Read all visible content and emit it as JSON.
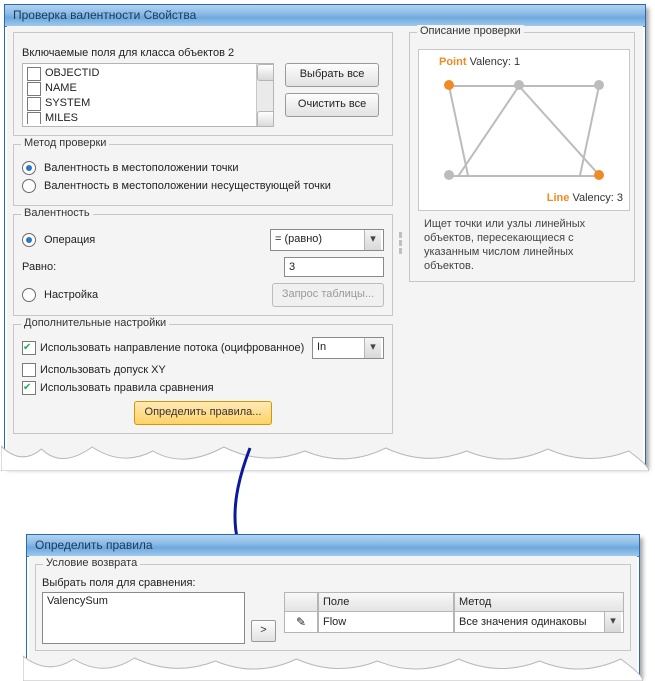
{
  "win1": {
    "title": "Проверка валентности Свойства",
    "fields_title": "Включаемые поля для класса объектов 2",
    "fields": [
      "OBJECTID",
      "NAME",
      "SYSTEM",
      "MILES"
    ],
    "btn_select_all": "Выбрать все",
    "btn_clear_all": "Очистить все",
    "method_title": "Метод проверки",
    "method_opt1": "Валентность в местоположении точки",
    "method_opt2": "Валентность в местоположении несуществующей точки",
    "valency_title": "Валентность",
    "valency_operation": "Операция",
    "valency_operator": "= (равно)",
    "valency_equals_label": "Равно:",
    "valency_equals_value": "3",
    "valency_tuning": "Настройка",
    "valency_query_btn": "Запрос таблицы...",
    "extra_title": "Дополнительные настройки",
    "extra_flow": "Использовать  направление  потока  (оцифрованное)",
    "extra_flow_sel": "In",
    "extra_xy": "Использовать допуск XY",
    "extra_rules": "Использовать правила сравнения",
    "define_rules_btn": "Определить правила...",
    "right_title": "Описание проверки",
    "preview_point_label": "Point",
    "preview_point_val": "Valency: 1",
    "preview_line_label": "Line",
    "preview_line_val": "Valency: 3",
    "desc": "Ищет точки или узлы линейных объектов, пересекающиеся с указанным числом линейных объектов."
  },
  "win2": {
    "title": "Определить правила",
    "cond_title": "Условие возврата",
    "pick_label": "Выбрать поля для сравнения:",
    "list_item": "ValencySum",
    "move_btn": ">",
    "col_field": "Поле",
    "col_method": "Метод",
    "row_field": "Flow",
    "row_method": "Все значения одинаковы",
    "row_icon": "✎"
  }
}
